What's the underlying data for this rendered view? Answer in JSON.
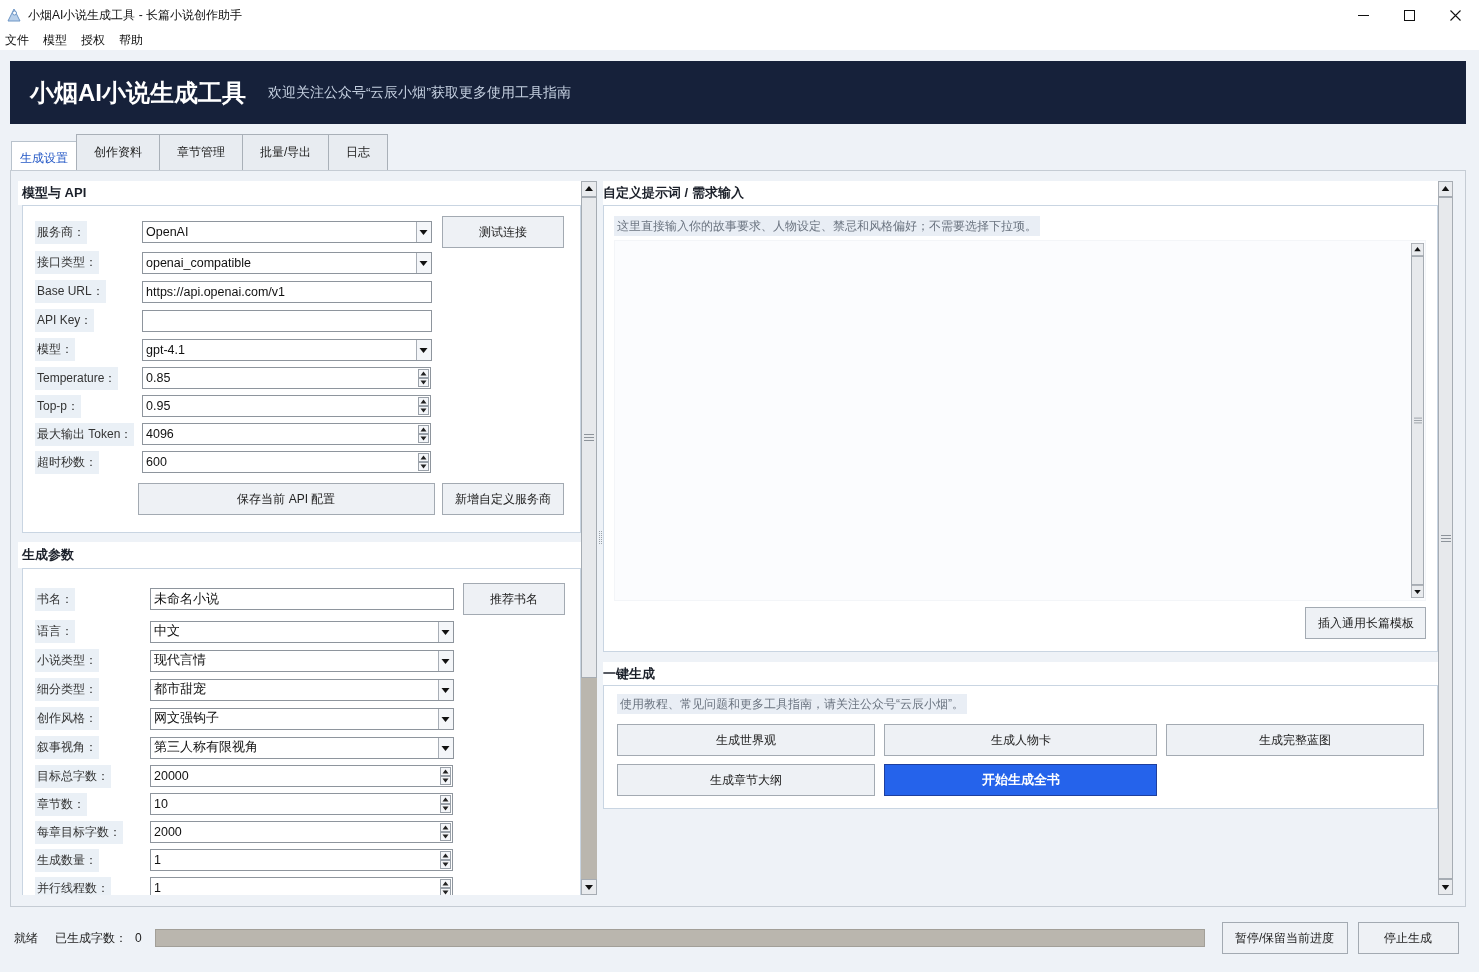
{
  "window": {
    "title": "小烟AI小说生成工具 - 长篇小说创作助手"
  },
  "menu_bar": {
    "items": [
      "文件",
      "模型",
      "授权",
      "帮助"
    ]
  },
  "header": {
    "title": "小烟AI小说生成工具",
    "subtitle": "欢迎关注公众号“云辰小烟”获取更多使用工具指南"
  },
  "tabs": [
    {
      "label": "生成设置",
      "selected": true
    },
    {
      "label": "创作资料",
      "selected": false
    },
    {
      "label": "章节管理",
      "selected": false
    },
    {
      "label": "批量/导出",
      "selected": false
    },
    {
      "label": "日志",
      "selected": false
    }
  ],
  "model_api": {
    "heading": "模型与 API",
    "fields": [
      {
        "label": "服务商：",
        "kind": "dropdown",
        "value": "OpenAI"
      },
      {
        "label": "接口类型：",
        "kind": "dropdown",
        "value": "openai_compatible"
      },
      {
        "label": "Base URL：",
        "kind": "text",
        "value": "https://api.openai.com/v1"
      },
      {
        "label": "API Key：",
        "kind": "text"
      },
      {
        "label": "模型：",
        "kind": "dropdown",
        "value": "gpt-4.1"
      },
      {
        "label": "Temperature：",
        "kind": "spin",
        "value": "0.85"
      },
      {
        "label": "Top-p：",
        "kind": "spin",
        "value": "0.95"
      },
      {
        "label": "最大输出 Token：",
        "kind": "spin",
        "value": "4096"
      },
      {
        "label": "超时秒数：",
        "kind": "spin",
        "value": "600"
      }
    ],
    "test_button": "测试连接",
    "save_button": "保存当前 API 配置",
    "add_provider_button": "新增自定义服务商"
  },
  "generation_params": {
    "heading": "生成参数",
    "fields": [
      {
        "label": "书名：",
        "kind": "text",
        "value": "未命名小说"
      },
      {
        "label": "语言：",
        "kind": "dropdown",
        "value": "中文"
      },
      {
        "label": "小说类型：",
        "kind": "dropdown",
        "value": "现代言情"
      },
      {
        "label": "细分类型：",
        "kind": "dropdown",
        "value": "都市甜宠"
      },
      {
        "label": "创作风格：",
        "kind": "dropdown",
        "value": "网文强钩子"
      },
      {
        "label": "叙事视角：",
        "kind": "dropdown",
        "value": "第三人称有限视角"
      },
      {
        "label": "目标总字数：",
        "kind": "spin",
        "value": "20000"
      },
      {
        "label": "章节数：",
        "kind": "spin",
        "value": "10"
      },
      {
        "label": "每章目标字数：",
        "kind": "spin",
        "value": "2000"
      },
      {
        "label": "生成数量：",
        "kind": "spin",
        "value": "1"
      },
      {
        "label": "并行线程数：",
        "kind": "spin",
        "value": "1"
      }
    ],
    "suggest_title_button": "推荐书名"
  },
  "custom_prompt": {
    "heading": "自定义提示词 / 需求输入",
    "hint": "这里直接输入你的故事要求、人物设定、禁忌和风格偏好；不需要选择下拉项。",
    "template_button": "插入通用长篇模板"
  },
  "one_click": {
    "heading": "一键生成",
    "hint": "使用教程、常见问题和更多工具指南，请关注公众号“云辰小烟”。",
    "buttons": [
      {
        "label": "生成世界观",
        "primary": false
      },
      {
        "label": "生成人物卡",
        "primary": false
      },
      {
        "label": "生成完整蓝图",
        "primary": false
      },
      {
        "label": "生成章节大纲",
        "primary": false
      },
      {
        "label": "开始生成全书",
        "primary": true
      }
    ]
  },
  "status_bar": {
    "status": "就绪",
    "count_label": "已生成字数：",
    "count": "0",
    "progress": {
      "level": 0
    },
    "buttons": [
      "暂停/保留当前进度",
      "停止生成"
    ]
  }
}
